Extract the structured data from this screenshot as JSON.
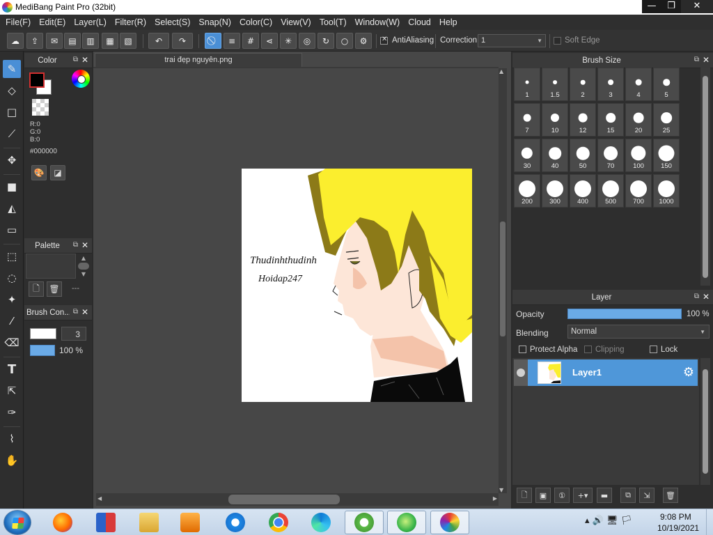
{
  "window": {
    "title": "MediBang Paint Pro (32bit)",
    "minimize_glyph": "—",
    "maximize_glyph": "❐",
    "close_glyph": "✕"
  },
  "menu": [
    "File(F)",
    "Edit(E)",
    "Layer(L)",
    "Filter(R)",
    "Select(S)",
    "Snap(N)",
    "Color(C)",
    "View(V)",
    "Tool(T)",
    "Window(W)",
    "Cloud",
    "Help"
  ],
  "toolbar": {
    "antialiasing_label": "AntiAliasing",
    "antialiasing_checked": true,
    "correction_label": "Correction",
    "correction_value": "1",
    "soft_edge_label": "Soft Edge",
    "soft_edge_checked": false,
    "icons": [
      "cloud-icon",
      "share-icon",
      "comment-icon",
      "speech-icon",
      "document-icon",
      "panel-icon",
      "screentone-icon",
      "undo-icon",
      "redo-icon",
      "snap-off-icon",
      "parallel-snap-icon",
      "grid-snap-icon",
      "vanishing-snap-icon",
      "radial-snap-icon",
      "concentric-snap-icon",
      "curve-snap-icon",
      "ellipse-snap-icon",
      "snap-settings-icon"
    ]
  },
  "tools": [
    "brush-tool-icon",
    "eraser-tool-icon",
    "shape-tool-icon",
    "select-brush-icon",
    "move-tool-icon",
    "fill-rect-icon",
    "bucket-tool-icon",
    "gradient-tool-icon",
    "select-rect-icon",
    "lasso-tool-icon",
    "magic-wand-icon",
    "select-pen-icon",
    "select-eraser-icon",
    "text-tool-icon",
    "operation-tool-icon",
    "divide-tool-icon",
    "eyedropper-tool-icon",
    "hand-tool-icon"
  ],
  "color_panel": {
    "title": "Color",
    "r": "R:0",
    "g": "G:0",
    "b": "B:0",
    "hex": "#000000",
    "foreground": "#000000",
    "background": "#ffffff"
  },
  "palette_panel": {
    "title": "Palette",
    "dash": "---"
  },
  "brush_control_panel": {
    "title": "Brush Con...",
    "size": "3",
    "opacity": "100 %",
    "opacity_fraction": 1.0
  },
  "document": {
    "tab_label": "trai đẹp nguyên.png",
    "watermark_line1": "Thudinhthudinh",
    "watermark_line2": "Hoidap247"
  },
  "brush_size_panel": {
    "title": "Brush Size",
    "sizes": [
      "1",
      "1.5",
      "2",
      "3",
      "4",
      "5",
      "7",
      "10",
      "12",
      "15",
      "20",
      "25",
      "30",
      "40",
      "50",
      "70",
      "100",
      "150",
      "200",
      "300",
      "400",
      "500",
      "700",
      "1000"
    ]
  },
  "layer_panel": {
    "title": "Layer",
    "opacity_label": "Opacity",
    "opacity_value": "100 %",
    "opacity_fraction": 1.0,
    "blending_label": "Blending",
    "blending_value": "Normal",
    "protect_alpha_label": "Protect Alpha",
    "clipping_label": "Clipping",
    "lock_label": "Lock",
    "layers": [
      {
        "name": "Layer1",
        "selected": true,
        "visible": true
      }
    ]
  },
  "taskbar": {
    "apps": [
      "firefox-icon",
      "unikey-icon",
      "file-explorer-icon",
      "media-player-icon",
      "internet-explorer-icon",
      "chrome-icon",
      "edge-icon",
      "coccoc-icon",
      "green-browser-icon",
      "medibang-icon"
    ],
    "time": "9:08 PM",
    "date": "10/19/2021"
  },
  "colors": {
    "accent_blue": "#4a8fd6",
    "hair_yellow": "#fbee2e",
    "hair_shadow": "#8c7a18",
    "skin": "#fde6d8",
    "blush": "#f4c3aa"
  }
}
